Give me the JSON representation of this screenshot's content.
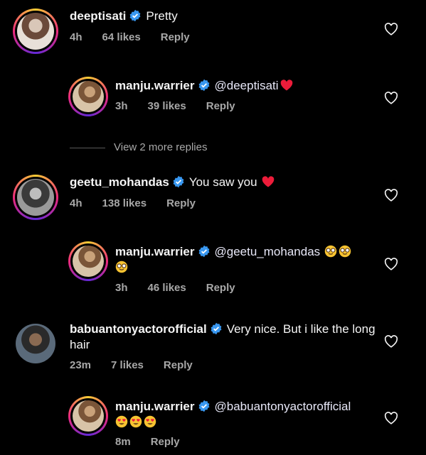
{
  "comments": [
    {
      "username": "deeptisati",
      "text": "Pretty",
      "time": "4h",
      "likes": "64 likes",
      "reply": "Reply"
    },
    {
      "username": "manju.warrier",
      "text": "@deeptisati",
      "time": "3h",
      "likes": "39 likes",
      "reply": "Reply"
    },
    {
      "username": "geetu_mohandas",
      "text": "You saw you",
      "time": "4h",
      "likes": "138 likes",
      "reply": "Reply"
    },
    {
      "username": "manju.warrier",
      "text": "@geetu_mohandas",
      "time": "3h",
      "likes": "46 likes",
      "reply": "Reply"
    },
    {
      "username": "babuantonyactorofficial",
      "text": "Very nice. But i like the long hair",
      "time": "23m",
      "likes": "7 likes",
      "reply": "Reply"
    },
    {
      "username": "manju.warrier",
      "text": "@babuantonyactorofficial",
      "time": "8m",
      "likes": "",
      "reply": "Reply"
    }
  ],
  "view_more": "View 2 more replies",
  "colors": {
    "verified": "#3897f0",
    "heart_red": "#ed1c3a",
    "meta": "#a8a8a8"
  }
}
